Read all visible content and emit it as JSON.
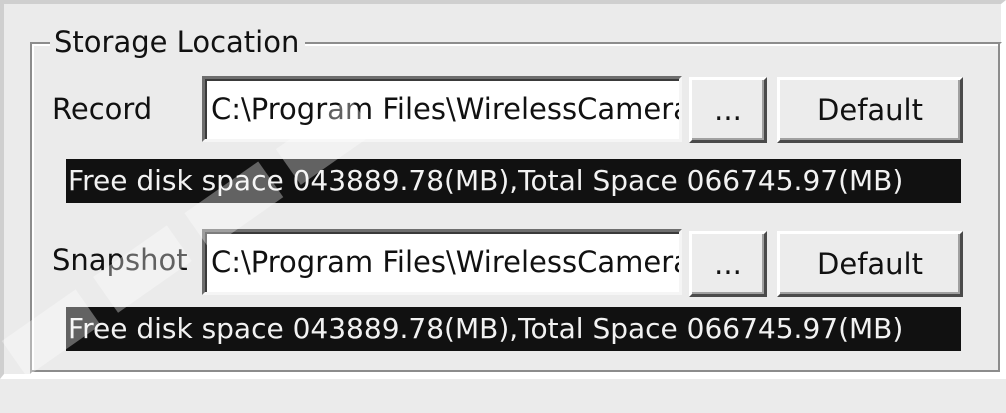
{
  "storage": {
    "title": "Storage Location",
    "record": {
      "label": "Record",
      "path": "C:\\Program Files\\WirelessCamera",
      "browse_label": "...",
      "default_label": "Default",
      "disk_info": "Free disk space 043889.78(MB),Total Space 066745.97(MB)"
    },
    "snapshot": {
      "label": "Snapshot",
      "path": "C:\\Program Files\\WirelessCamera",
      "browse_label": "...",
      "default_label": "Default",
      "disk_info": "Free disk space 043889.78(MB),Total Space 066745.97(MB)"
    }
  }
}
